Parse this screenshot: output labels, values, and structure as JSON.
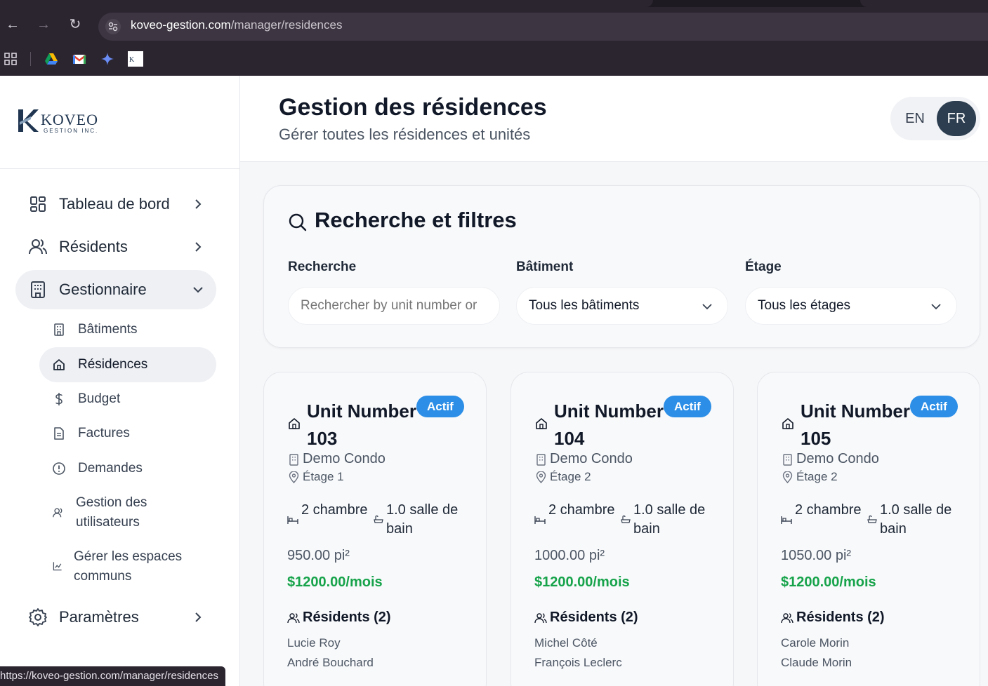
{
  "browser": {
    "url_host": "koveo-gestion.com",
    "url_path": "/manager/residences",
    "status_url": "https://koveo-gestion.com/manager/residences"
  },
  "brand": {
    "name": "KOVEO",
    "subtitle": "GESTION INC."
  },
  "sidebar": {
    "items": [
      {
        "label": "Tableau de bord"
      },
      {
        "label": "Résidents"
      },
      {
        "label": "Gestionnaire"
      },
      {
        "label": "Paramètres"
      }
    ],
    "manager_subitems": [
      {
        "label": "Bâtiments"
      },
      {
        "label": "Résidences"
      },
      {
        "label": "Budget"
      },
      {
        "label": "Factures"
      },
      {
        "label": "Demandes"
      },
      {
        "label": "Gestion des utilisateurs"
      },
      {
        "label": "Gérer les espaces communs"
      }
    ]
  },
  "header": {
    "title": "Gestion des résidences",
    "subtitle": "Gérer toutes les résidences et unités",
    "lang_en": "EN",
    "lang_fr": "FR"
  },
  "filters": {
    "title": "Recherche et filtres",
    "search_label": "Recherche",
    "search_placeholder": "Rechercher by unit number or",
    "building_label": "Bâtiment",
    "building_value": "Tous les bâtiments",
    "floor_label": "Étage",
    "floor_value": "Tous les étages"
  },
  "units": [
    {
      "title": "Unit Number 103",
      "status": "Actif",
      "building": "Demo Condo",
      "floor": "Étage 1",
      "bedrooms": "2 chambre",
      "bathrooms": "1.0 salle de bain",
      "area": "950.00 pi²",
      "rent": "$1200.00/mois",
      "residents_title": "Résidents (2)",
      "residents": [
        "Lucie Roy",
        "André Bouchard"
      ]
    },
    {
      "title": "Unit Number 104",
      "status": "Actif",
      "building": "Demo Condo",
      "floor": "Étage 2",
      "bedrooms": "2 chambre",
      "bathrooms": "1.0 salle de bain",
      "area": "1000.00 pi²",
      "rent": "$1200.00/mois",
      "residents_title": "Résidents (2)",
      "residents": [
        "Michel Côté",
        "François Leclerc"
      ]
    },
    {
      "title": "Unit Number 105",
      "status": "Actif",
      "building": "Demo Condo",
      "floor": "Étage 2",
      "bedrooms": "2 chambre",
      "bathrooms": "1.0 salle de bain",
      "area": "1050.00 pi²",
      "rent": "$1200.00/mois",
      "residents_title": "Résidents (2)",
      "residents": [
        "Carole Morin",
        "Claude Morin"
      ]
    }
  ],
  "colors": {
    "accent": "#2c3e50",
    "badge": "#2c8ee6",
    "rent": "#16a34a"
  }
}
